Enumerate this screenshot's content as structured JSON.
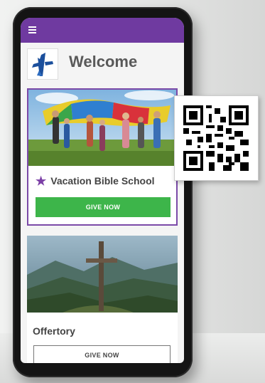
{
  "header": {
    "title": "Welcome",
    "menu_icon": "hamburger-menu-icon"
  },
  "colors": {
    "header": "#6f3aa0",
    "give_button": "#3db54a",
    "accent": "#7b4aa8"
  },
  "cards": [
    {
      "title": "Vacation Bible School",
      "icon": "star-icon",
      "button_label": "GIVE NOW",
      "image": "children-under-parachute"
    },
    {
      "title": "Offertory",
      "button_label": "GIVE NOW",
      "image": "cross-on-mountain"
    }
  ],
  "qr_code": {
    "icon": "qr-code-icon"
  }
}
